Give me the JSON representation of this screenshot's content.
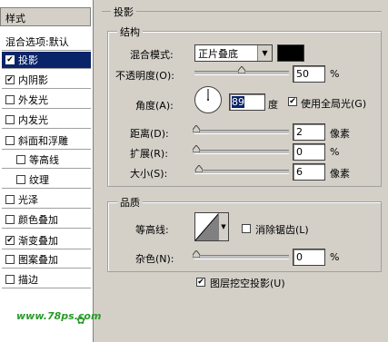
{
  "sidebar": {
    "title": "样式",
    "items": [
      {
        "label": "混合选项:默认",
        "checkbox": false
      },
      {
        "label": "投影",
        "checked": true,
        "selected": true
      },
      {
        "label": "内阴影",
        "checked": true
      },
      {
        "label": "外发光",
        "checked": false
      },
      {
        "label": "内发光",
        "checked": false
      },
      {
        "label": "斜面和浮雕",
        "checked": false
      },
      {
        "label": "等高线",
        "checked": false
      },
      {
        "label": "纹理",
        "checked": false
      },
      {
        "label": "光泽",
        "checked": false
      },
      {
        "label": "颜色叠加",
        "checked": false
      },
      {
        "label": "渐变叠加",
        "checked": true
      },
      {
        "label": "图案叠加",
        "checked": false
      },
      {
        "label": "描边",
        "checked": false
      }
    ],
    "logo_text": "www.78ps.com"
  },
  "panel": {
    "section_title": "投影",
    "structure": {
      "title": "结构",
      "blend_mode_label": "混合模式:",
      "blend_mode_value": "正片叠底",
      "shadow_color": "#000000",
      "opacity_label": "不透明度(O):",
      "opacity_value": "50",
      "opacity_unit": "%",
      "opacity_level": 0.5,
      "angle_label": "角度(A):",
      "angle_value": "89",
      "angle_unit": "度",
      "global_light_label": "使用全局光(G)",
      "global_light_checked": true,
      "distance_label": "距离(D):",
      "distance_value": "2",
      "distance_unit": "像素",
      "spread_label": "扩展(R):",
      "spread_value": "0",
      "spread_unit": "%",
      "size_label": "大小(S):",
      "size_value": "6",
      "size_unit": "像素"
    },
    "quality": {
      "title": "品质",
      "contour_label": "等高线:",
      "anti_alias_label": "消除锯齿(L)",
      "anti_alias_checked": false,
      "noise_label": "杂色(N):",
      "noise_value": "0",
      "noise_unit": "%"
    },
    "knockout_label": "图层挖空投影(U)",
    "knockout_checked": true
  }
}
